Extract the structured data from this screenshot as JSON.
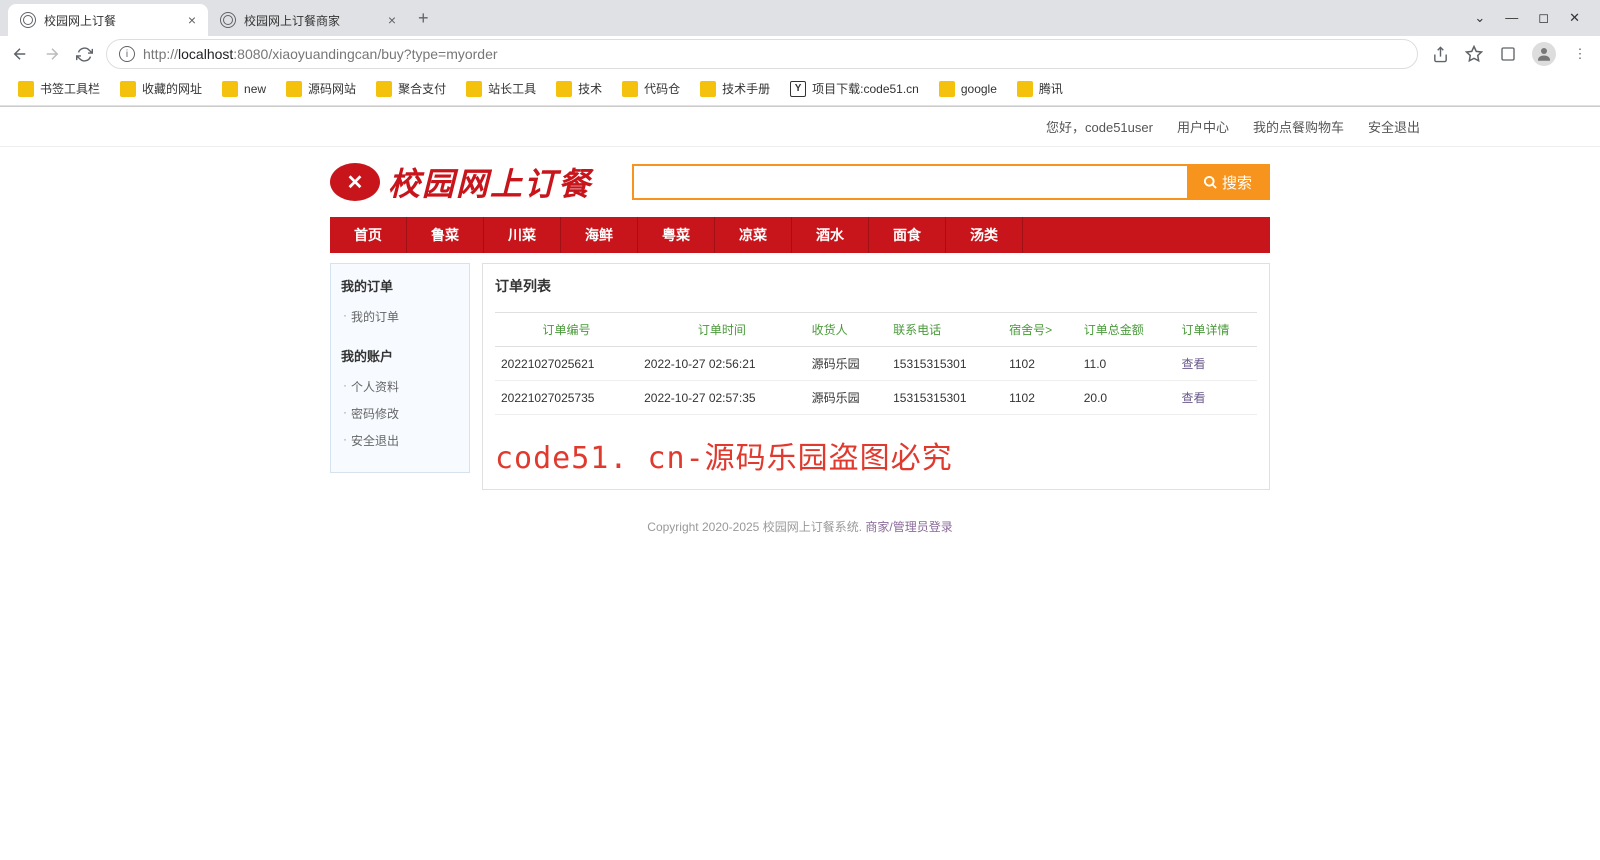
{
  "browser": {
    "tabs": [
      {
        "title": "校园网上订餐"
      },
      {
        "title": "校园网上订餐商家"
      }
    ],
    "url_prefix": "http://",
    "url_host": "localhost",
    "url_port": ":8080",
    "url_path": "/xiaoyuandingcan/buy?type=myorder",
    "bookmarks": [
      "书签工具栏",
      "收藏的网址",
      "new",
      "源码网站",
      "聚合支付",
      "站长工具",
      "技术",
      "代码仓",
      "技术手册",
      "项目下载:code51.cn",
      "google",
      "腾讯"
    ]
  },
  "topbar": {
    "greeting": "您好，code51user",
    "links": [
      "用户中心",
      "我的点餐购物车",
      "安全退出"
    ]
  },
  "logo_text": "校园网上订餐",
  "search": {
    "placeholder": "",
    "button": "搜索"
  },
  "nav": [
    "首页",
    "鲁菜",
    "川菜",
    "海鲜",
    "粤菜",
    "凉菜",
    "酒水",
    "面食",
    "汤类"
  ],
  "sidebar": {
    "groups": [
      {
        "title": "我的订单",
        "items": [
          "我的订单"
        ]
      },
      {
        "title": "我的账户",
        "items": [
          "个人资料",
          "密码修改",
          "安全退出"
        ]
      }
    ]
  },
  "content": {
    "title": "订单列表",
    "headers": [
      "订单编号",
      "订单时间",
      "收货人",
      "联系电话",
      "宿舍号>",
      "订单总金额",
      "订单详情"
    ],
    "rows": [
      {
        "id": "20221027025621",
        "time": "2022-10-27 02:56:21",
        "receiver": "源码乐园",
        "phone": "15315315301",
        "dorm": "1102",
        "total": "11.0",
        "detail": "查看"
      },
      {
        "id": "20221027025735",
        "time": "2022-10-27 02:57:35",
        "receiver": "源码乐园",
        "phone": "15315315301",
        "dorm": "1102",
        "total": "20.0",
        "detail": "查看"
      }
    ],
    "watermark": "code51. cn-源码乐园盗图必究"
  },
  "footer": {
    "copyright": "Copyright 2020-2025 校园网上订餐系统.",
    "login_link": "商家/管理员登录"
  }
}
